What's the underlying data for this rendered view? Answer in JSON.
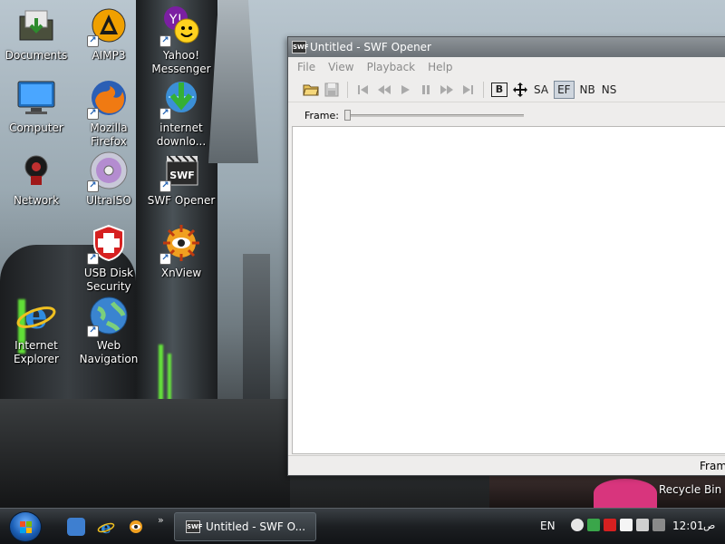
{
  "desktop": {
    "icons": [
      {
        "label": "Documents",
        "icon": "folder-icon"
      },
      {
        "label": "AIMP3",
        "icon": "aimp-icon"
      },
      {
        "label": "Yahoo! Messenger",
        "icon": "yahoo-messenger-icon"
      },
      {
        "label": "Computer",
        "icon": "computer-icon"
      },
      {
        "label": "Mozilla Firefox",
        "icon": "firefox-icon"
      },
      {
        "label": "internet downlo...",
        "icon": "internet-download-manager-icon"
      },
      {
        "label": "Network",
        "icon": "network-icon"
      },
      {
        "label": "UltraISO",
        "icon": "ultraiso-icon"
      },
      {
        "label": "SWF Opener",
        "icon": "swf-opener-icon"
      },
      {
        "label": "USB Disk Security",
        "icon": "usb-disk-security-icon"
      },
      {
        "label": "XnView",
        "icon": "xnview-icon"
      },
      {
        "label": "Internet Explorer",
        "icon": "internet-explorer-icon"
      },
      {
        "label": "Web Navigation",
        "icon": "web-navigation-icon"
      }
    ],
    "recycle_bin": "Recycle Bin"
  },
  "window": {
    "title": "Untitled - SWF Opener",
    "app_icon_text": "SWF",
    "menus": [
      "File",
      "View",
      "Playback",
      "Help"
    ],
    "toolbar": {
      "bold_label": "B",
      "sa_label": "SA",
      "ef_label": "EF",
      "nb_label": "NB",
      "ns_label": "NS"
    },
    "frame_label": "Frame:",
    "frame_position": 0,
    "status_text": "Fram"
  },
  "taskbar": {
    "task_title": "Untitled - SWF O...",
    "chevron": "»",
    "language": "EN",
    "clock": "12:01",
    "ampm": "ص"
  },
  "colors": {
    "taskbar": "#1c1f22",
    "window_title": "#6b7176",
    "accent_blue": "#1b5fb6"
  }
}
